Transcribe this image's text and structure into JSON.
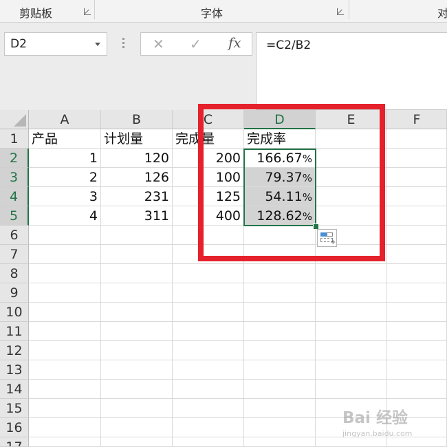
{
  "ribbon": {
    "groups": [
      {
        "label": "剪贴板"
      },
      {
        "label": "字体"
      },
      {
        "label": "对"
      }
    ]
  },
  "formula_bar": {
    "name_box": "D2",
    "cancel_glyph": "✕",
    "enter_glyph": "✓",
    "fx_label": "fx",
    "formula": "=C2/B2"
  },
  "grid": {
    "columns": [
      "A",
      "B",
      "C",
      "D",
      "E",
      "F"
    ],
    "rows": [
      "1",
      "2",
      "3",
      "4",
      "5",
      "6",
      "7",
      "8",
      "9",
      "10",
      "11",
      "12",
      "13",
      "14",
      "15",
      "16",
      "17"
    ],
    "cells": {
      "A1": "产品",
      "B1": "计划量",
      "C1": "完成量",
      "D1": "完成率",
      "A2": "1",
      "B2": "120",
      "C2": "200",
      "D2": "166.67",
      "A3": "2",
      "B3": "126",
      "C3": "100",
      "D3": "79.37",
      "A4": "3",
      "B4": "231",
      "C4": "125",
      "D4": "54.11",
      "A5": "4",
      "B5": "311",
      "C5": "400",
      "D5": "128.62"
    },
    "percent_sign": "%"
  },
  "watermark": {
    "brand": "Bai 经验",
    "url": "jingyan.baidu.com"
  },
  "colors": {
    "selection": "#217346",
    "highlight": "#e5212b"
  }
}
